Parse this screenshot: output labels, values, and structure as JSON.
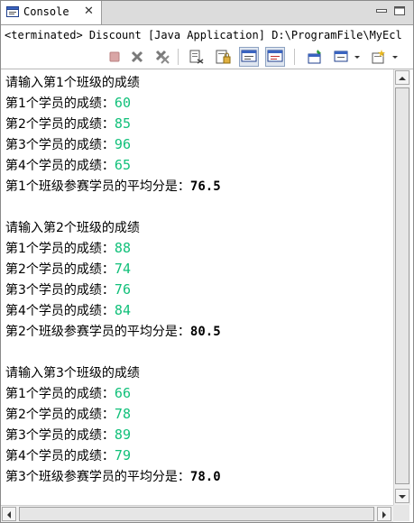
{
  "tab": {
    "label": "Console",
    "close_glyph": "✕",
    "icon": "console-icon"
  },
  "window_buttons": [
    "minimize-icon",
    "maximize-icon"
  ],
  "status_line": "<terminated> Discount [Java Application] D:\\ProgramFile\\MyEcl",
  "toolbar": {
    "buttons": [
      "terminate-icon",
      "remove-launch-icon",
      "remove-all-terminated-icon",
      "clear-console-icon",
      "scroll-lock-icon",
      "show-on-stdout-icon",
      "show-on-stderr-icon",
      "pin-console-icon",
      "display-selected-console-icon",
      "open-console-icon"
    ]
  },
  "console": {
    "classes": [
      {
        "prompt": "请输入第1个班级的成绩",
        "students": [
          {
            "label": "第1个学员的成绩：",
            "score": "60"
          },
          {
            "label": "第2个学员的成绩：",
            "score": "85"
          },
          {
            "label": "第3个学员的成绩：",
            "score": "96"
          },
          {
            "label": "第4个学员的成绩：",
            "score": "65"
          }
        ],
        "average_label": "第1个班级参赛学员的平均分是：",
        "average": "76.5"
      },
      {
        "prompt": "请输入第2个班级的成绩",
        "students": [
          {
            "label": "第1个学员的成绩：",
            "score": "88"
          },
          {
            "label": "第2个学员的成绩：",
            "score": "74"
          },
          {
            "label": "第3个学员的成绩：",
            "score": "76"
          },
          {
            "label": "第4个学员的成绩：",
            "score": "84"
          }
        ],
        "average_label": "第2个班级参赛学员的平均分是：",
        "average": "80.5"
      },
      {
        "prompt": "请输入第3个班级的成绩",
        "students": [
          {
            "label": "第1个学员的成绩：",
            "score": "66"
          },
          {
            "label": "第2个学员的成绩：",
            "score": "78"
          },
          {
            "label": "第3个学员的成绩：",
            "score": "89"
          },
          {
            "label": "第4个学员的成绩：",
            "score": "79"
          }
        ],
        "average_label": "第3个班级参赛学员的平均分是：",
        "average": "78.0"
      }
    ]
  },
  "colors": {
    "input_number": "#11c07a",
    "output_text": "#000000",
    "tab_strip": "#dcdcdc"
  }
}
